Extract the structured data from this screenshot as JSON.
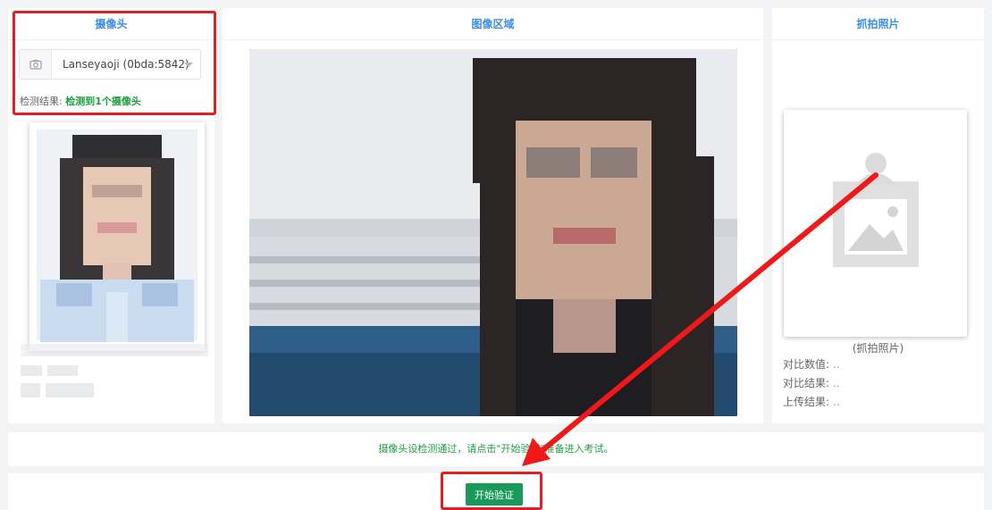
{
  "left": {
    "title": "摄像头",
    "camera_select": {
      "value": "Lanseyaoji (0bda:5842)",
      "icon": "camera-icon"
    },
    "detect_label": "检测结果:",
    "detect_result": "检测到1个摄像头"
  },
  "middle": {
    "title": "图像区域"
  },
  "right": {
    "title": "抓拍照片",
    "placeholder_icon": "image-placeholder-icon",
    "caption": "(抓拍照片)",
    "compare_value_label": "对比数值:",
    "compare_value": "..",
    "compare_result_label": "对比结果:",
    "compare_result": "..",
    "upload_result_label": "上传结果:",
    "upload_result": ".."
  },
  "notice": "摄像头设检测通过，请点击\"开始验证\"准备进入考试。",
  "start_button_label": "开始验证",
  "colors": {
    "accent": "#3a8ee6",
    "success": "#1e9e42",
    "button": "#199a5a",
    "highlight": "#e02020"
  }
}
